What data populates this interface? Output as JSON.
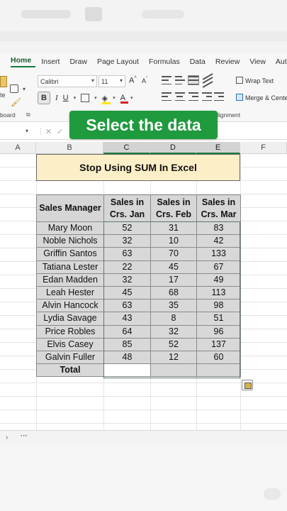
{
  "ribbon_tabs": [
    "Home",
    "Insert",
    "Draw",
    "Page Layout",
    "Formulas",
    "Data",
    "Review",
    "View",
    "Automa"
  ],
  "clipboard": {
    "paste_label": "te",
    "group_label": "board"
  },
  "font": {
    "name": "Calibri",
    "size": "11",
    "bold": "B",
    "italic": "I",
    "underline": "U",
    "grow": "A",
    "shrink": "A",
    "font_color_glyph": "A"
  },
  "alignment": {
    "wrap_text": "Wrap Text",
    "merge_center": "Merge & Cente",
    "group_label": "lignment"
  },
  "callout": "Select the data",
  "column_headers": [
    "A",
    "B",
    "C",
    "D",
    "E",
    "F"
  ],
  "sheet": {
    "title": "Stop Using SUM In Excel",
    "headers": [
      {
        "line1": "Sales Manager",
        "line2": ""
      },
      {
        "line1": "Sales in",
        "line2": "Crs. Jan"
      },
      {
        "line1": "Sales in",
        "line2": "Crs. Feb"
      },
      {
        "line1": "Sales in",
        "line2": "Crs. Mar"
      }
    ],
    "rows": [
      [
        "Mary Moon",
        "52",
        "31",
        "83"
      ],
      [
        "Noble Nichols",
        "32",
        "10",
        "42"
      ],
      [
        "Griffin Santos",
        "63",
        "70",
        "133"
      ],
      [
        "Tatiana Lester",
        "22",
        "45",
        "67"
      ],
      [
        "Edan Madden",
        "32",
        "17",
        "49"
      ],
      [
        "Leah Hester",
        "45",
        "68",
        "113"
      ],
      [
        "Alvin Hancock",
        "63",
        "35",
        "98"
      ],
      [
        "Lydia Savage",
        "43",
        "8",
        "51"
      ],
      [
        "Price Robles",
        "64",
        "32",
        "96"
      ],
      [
        "Elvis Casey",
        "85",
        "52",
        "137"
      ],
      [
        "Galvin Fuller",
        "48",
        "12",
        "60"
      ]
    ],
    "total_label": "Total"
  },
  "sheet_bar": {
    "nav": "›",
    "more": "···"
  },
  "colors": {
    "accent_green": "#1f9a3e",
    "title_fill": "#fcefc8",
    "table_fill": "#d8d8d8"
  }
}
